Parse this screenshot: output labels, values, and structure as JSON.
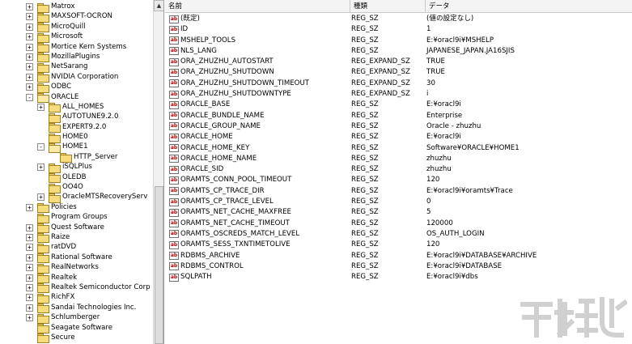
{
  "tree": {
    "items": [
      {
        "label": "Matrox",
        "level": 0,
        "expander": "+"
      },
      {
        "label": "MAXSOFT-OCRON",
        "level": 0,
        "expander": "+"
      },
      {
        "label": "MicroQuill",
        "level": 0,
        "expander": "+"
      },
      {
        "label": "Microsoft",
        "level": 0,
        "expander": "+"
      },
      {
        "label": "Mortice Kern Systems",
        "level": 0,
        "expander": "+"
      },
      {
        "label": "MozillaPlugins",
        "level": 0,
        "expander": "+"
      },
      {
        "label": "NetSarang",
        "level": 0,
        "expander": "+"
      },
      {
        "label": "NVIDIA Corporation",
        "level": 0,
        "expander": "+"
      },
      {
        "label": "ODBC",
        "level": 0,
        "expander": "+"
      },
      {
        "label": "ORACLE",
        "level": 0,
        "expander": "-"
      },
      {
        "label": "ALL_HOMES",
        "level": 1,
        "expander": "+"
      },
      {
        "label": "AUTOTUNE9.2.0",
        "level": 1,
        "expander": ""
      },
      {
        "label": "EXPERT9.2.0",
        "level": 1,
        "expander": ""
      },
      {
        "label": "HOME0",
        "level": 1,
        "expander": ""
      },
      {
        "label": "HOME1",
        "level": 1,
        "expander": "-"
      },
      {
        "label": "HTTP_Server",
        "level": 2,
        "expander": ""
      },
      {
        "label": "iSQLPlus",
        "level": 1,
        "expander": "+"
      },
      {
        "label": "OLEDB",
        "level": 1,
        "expander": ""
      },
      {
        "label": "OO4O",
        "level": 1,
        "expander": ""
      },
      {
        "label": "OracleMTSRecoveryServ",
        "level": 1,
        "expander": "+"
      },
      {
        "label": "Policies",
        "level": 0,
        "expander": "+"
      },
      {
        "label": "Program Groups",
        "level": 0,
        "expander": ""
      },
      {
        "label": "Quest Software",
        "level": 0,
        "expander": "+"
      },
      {
        "label": "Raize",
        "level": 0,
        "expander": "+"
      },
      {
        "label": "ratDVD",
        "level": 0,
        "expander": "+"
      },
      {
        "label": "Rational Software",
        "level": 0,
        "expander": "+"
      },
      {
        "label": "RealNetworks",
        "level": 0,
        "expander": "+"
      },
      {
        "label": "Realtek",
        "level": 0,
        "expander": "+"
      },
      {
        "label": "Realtek Semiconductor Corp",
        "level": 0,
        "expander": "+"
      },
      {
        "label": "RichFX",
        "level": 0,
        "expander": "+"
      },
      {
        "label": "Sandai Technologies Inc.",
        "level": 0,
        "expander": "+"
      },
      {
        "label": "Schlumberger",
        "level": 0,
        "expander": "+"
      },
      {
        "label": "Seagate Software",
        "level": 0,
        "expander": ""
      },
      {
        "label": "Secure",
        "level": 0,
        "expander": ""
      }
    ]
  },
  "list": {
    "headers": {
      "name": "名前",
      "type": "種類",
      "data": "データ"
    },
    "icon_text": "ab",
    "rows": [
      {
        "name": "(既定)",
        "type": "REG_SZ",
        "data": "(値の設定なし)"
      },
      {
        "name": "ID",
        "type": "REG_SZ",
        "data": "1"
      },
      {
        "name": "MSHELP_TOOLS",
        "type": "REG_SZ",
        "data": "E:¥oracl9i¥MSHELP"
      },
      {
        "name": "NLS_LANG",
        "type": "REG_SZ",
        "data": "JAPANESE_JAPAN.JA16SJIS"
      },
      {
        "name": "ORA_ZHUZHU_AUTOSTART",
        "type": "REG_EXPAND_SZ",
        "data": "TRUE"
      },
      {
        "name": "ORA_ZHUZHU_SHUTDOWN",
        "type": "REG_EXPAND_SZ",
        "data": "TRUE"
      },
      {
        "name": "ORA_ZHUZHU_SHUTDOWN_TIMEOUT",
        "type": "REG_EXPAND_SZ",
        "data": "30"
      },
      {
        "name": "ORA_ZHUZHU_SHUTDOWNTYPE",
        "type": "REG_EXPAND_SZ",
        "data": "i"
      },
      {
        "name": "ORACLE_BASE",
        "type": "REG_SZ",
        "data": "E:¥oracl9i"
      },
      {
        "name": "ORACLE_BUNDLE_NAME",
        "type": "REG_SZ",
        "data": "Enterprise"
      },
      {
        "name": "ORACLE_GROUP_NAME",
        "type": "REG_SZ",
        "data": "Oracle - zhuzhu"
      },
      {
        "name": "ORACLE_HOME",
        "type": "REG_SZ",
        "data": "E:¥oracl9i"
      },
      {
        "name": "ORACLE_HOME_KEY",
        "type": "REG_SZ",
        "data": "Software¥ORACLE¥HOME1"
      },
      {
        "name": "ORACLE_HOME_NAME",
        "type": "REG_SZ",
        "data": "zhuzhu"
      },
      {
        "name": "ORACLE_SID",
        "type": "REG_SZ",
        "data": "zhuzhu"
      },
      {
        "name": "ORAMTS_CONN_POOL_TIMEOUT",
        "type": "REG_SZ",
        "data": "120"
      },
      {
        "name": "ORAMTS_CP_TRACE_DIR",
        "type": "REG_SZ",
        "data": "E:¥oracl9i¥oramts¥Trace"
      },
      {
        "name": "ORAMTS_CP_TRACE_LEVEL",
        "type": "REG_SZ",
        "data": "0"
      },
      {
        "name": "ORAMTS_NET_CACHE_MAXFREE",
        "type": "REG_SZ",
        "data": "5"
      },
      {
        "name": "ORAMTS_NET_CACHE_TIMEOUT",
        "type": "REG_SZ",
        "data": "120000"
      },
      {
        "name": "ORAMTS_OSCREDS_MATCH_LEVEL",
        "type": "REG_SZ",
        "data": "OS_AUTH_LOGIN"
      },
      {
        "name": "ORAMTS_SESS_TXNTIMETOLIVE",
        "type": "REG_SZ",
        "data": "120"
      },
      {
        "name": "RDBMS_ARCHIVE",
        "type": "REG_SZ",
        "data": "E:¥oracl9i¥DATABASE¥ARCHIVE"
      },
      {
        "name": "RDBMS_CONTROL",
        "type": "REG_SZ",
        "data": "E:¥oracl9i¥DATABASE"
      },
      {
        "name": "SQLPATH",
        "type": "REG_SZ",
        "data": "E:¥oracl9i¥dbs"
      }
    ]
  },
  "colors": {
    "icon_text": "#b00000",
    "folder": "#f6dc7a",
    "header_bg": "#f4f4f4",
    "watermark": "#d0d0d0"
  }
}
